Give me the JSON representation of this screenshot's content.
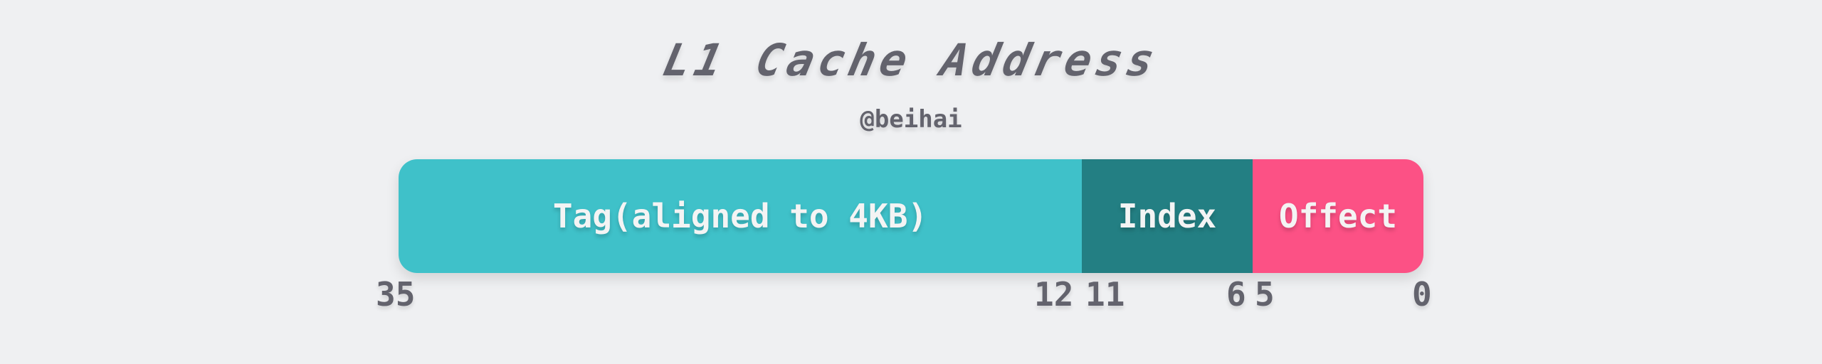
{
  "title": "L1 Cache Address",
  "subtitle": "@beihai",
  "colors": {
    "background": "#eff0f2",
    "text": "#63636d",
    "tag": "#3fc1c9",
    "index": "#237f83",
    "offset": "#fc5185"
  },
  "segments": [
    {
      "label": "Tag(aligned to 4KB)",
      "high_bit": 35,
      "low_bit": 12,
      "color": "#3fc1c9"
    },
    {
      "label": "Index",
      "high_bit": 11,
      "low_bit": 6,
      "color": "#237f83"
    },
    {
      "label": "Offect",
      "high_bit": 5,
      "low_bit": 0,
      "color": "#fc5185"
    }
  ],
  "bit_labels": [
    "35",
    "12",
    "11",
    "6",
    "5",
    "0"
  ]
}
